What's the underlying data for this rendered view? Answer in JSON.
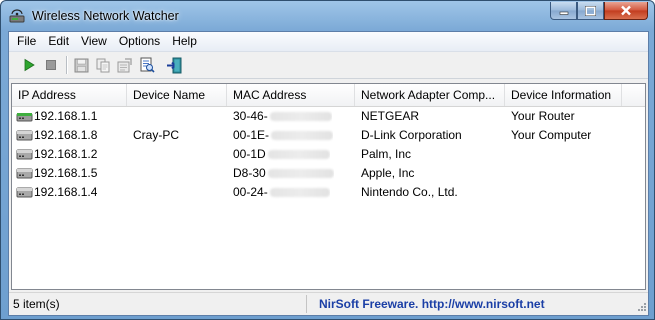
{
  "window": {
    "title": "Wireless Network Watcher",
    "icon": "wireless-network-icon"
  },
  "caption_buttons": {
    "minimize_icon": "minimize-icon",
    "maximize_icon": "maximize-icon",
    "close_icon": "close-icon"
  },
  "menu": [
    "File",
    "Edit",
    "View",
    "Options",
    "Help"
  ],
  "toolbar": {
    "buttons": [
      "play-icon",
      "stop-icon",
      "save-icon",
      "copy-icon",
      "properties-icon",
      "html-report-icon",
      "exit-icon"
    ]
  },
  "list": {
    "columns": [
      "IP Address",
      "Device Name",
      "MAC Address",
      "Network Adapter Comp...",
      "Device Information"
    ],
    "rows": [
      {
        "ip": "192.168.1.1",
        "device": "",
        "mac": "30-46-",
        "vendor": "NETGEAR",
        "info": "Your Router",
        "icon": "router-icon"
      },
      {
        "ip": "192.168.1.8",
        "device": "Cray-PC",
        "mac": "00-1E-",
        "vendor": "D-Link Corporation",
        "info": "Your Computer",
        "icon": "computer-device-icon"
      },
      {
        "ip": "192.168.1.2",
        "device": "",
        "mac": "00-1D",
        "vendor": "Palm, Inc",
        "info": "",
        "icon": "computer-device-icon"
      },
      {
        "ip": "192.168.1.5",
        "device": "",
        "mac": "D8-30",
        "vendor": "Apple, Inc",
        "info": "",
        "icon": "computer-device-icon"
      },
      {
        "ip": "192.168.1.4",
        "device": "",
        "mac": "00-24-",
        "vendor": "Nintendo Co., Ltd.",
        "info": "",
        "icon": "computer-device-icon"
      }
    ]
  },
  "statusbar": {
    "count": "5 item(s)",
    "credit": "NirSoft Freeware.  http://www.nirsoft.net"
  },
  "colors": {
    "link": "#1b3fa6",
    "router_green": "#3fae3f"
  }
}
